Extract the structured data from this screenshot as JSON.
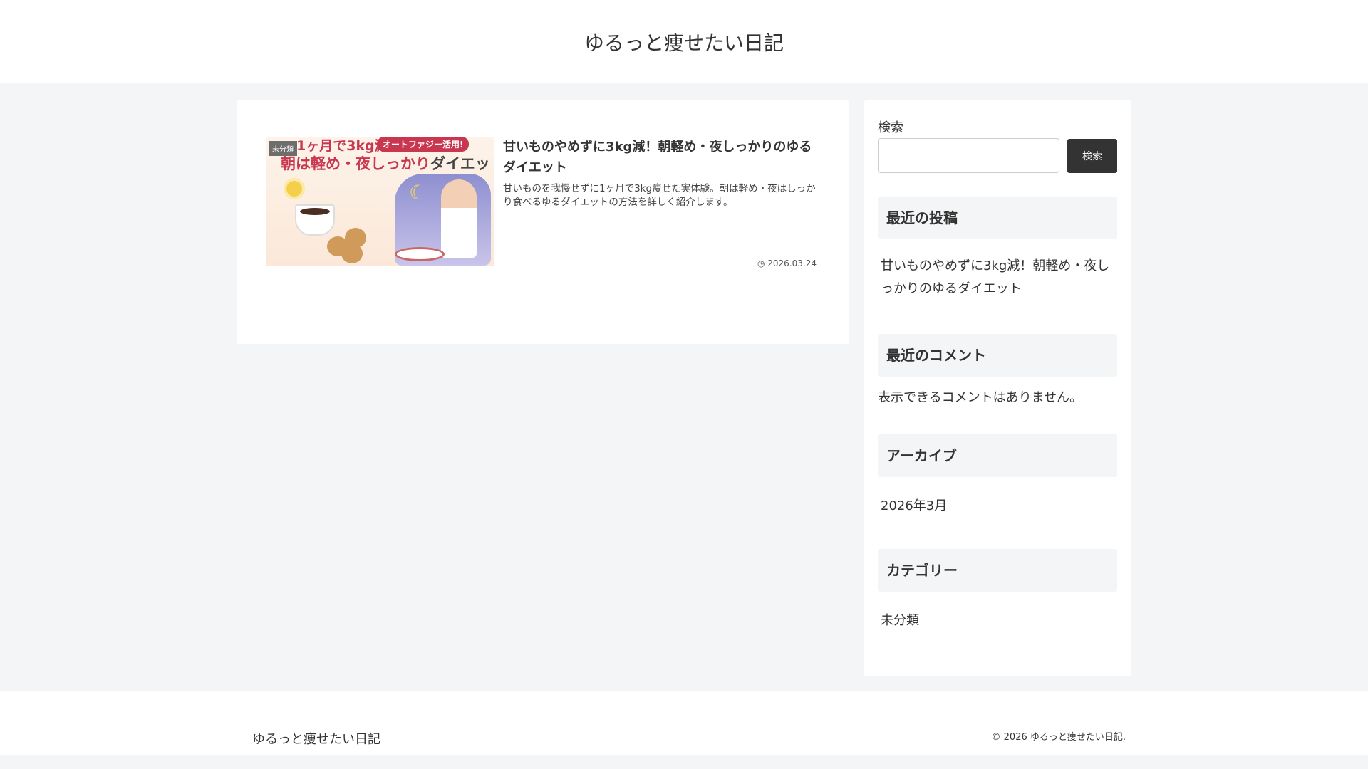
{
  "header": {
    "site_title": "ゆるっと痩せたい日記"
  },
  "post": {
    "category_badge": "未分類",
    "thumbnail": {
      "line1": "1ヶ月で3kg減",
      "badge": "オートファジー活用!",
      "line2_red": "朝は軽め・夜しっかり",
      "line2_dark": "ダイエット"
    },
    "title": "甘いものやめずに3kg減！朝軽め・夜しっかりのゆるダイエット",
    "excerpt": "甘いものを我慢せずに1ヶ月で3kg痩せた実体験。朝は軽め・夜はしっかり食べるゆるダイエットの方法を詳しく紹介します。",
    "date": "2026.03.24",
    "date_icon": "clock-icon"
  },
  "sidebar": {
    "search_label": "検索",
    "search_value": "",
    "search_button": "検索",
    "recent_posts_heading": "最近の投稿",
    "recent_posts": [
      "甘いものやめずに3kg減！朝軽め・夜しっかりのゆるダイエット"
    ],
    "recent_comments_heading": "最近のコメント",
    "recent_comments_empty": "表示できるコメントはありません。",
    "archives_heading": "アーカイブ",
    "archives": [
      "2026年3月"
    ],
    "categories_heading": "カテゴリー",
    "categories": [
      "未分類"
    ]
  },
  "footer": {
    "site_title": "ゆるっと痩せたい日記",
    "copyright": "© 2026 ゆるっと痩せたい日記."
  },
  "colors": {
    "accent": "#c8374f",
    "button": "#333333",
    "background": "#f4f5f7"
  }
}
